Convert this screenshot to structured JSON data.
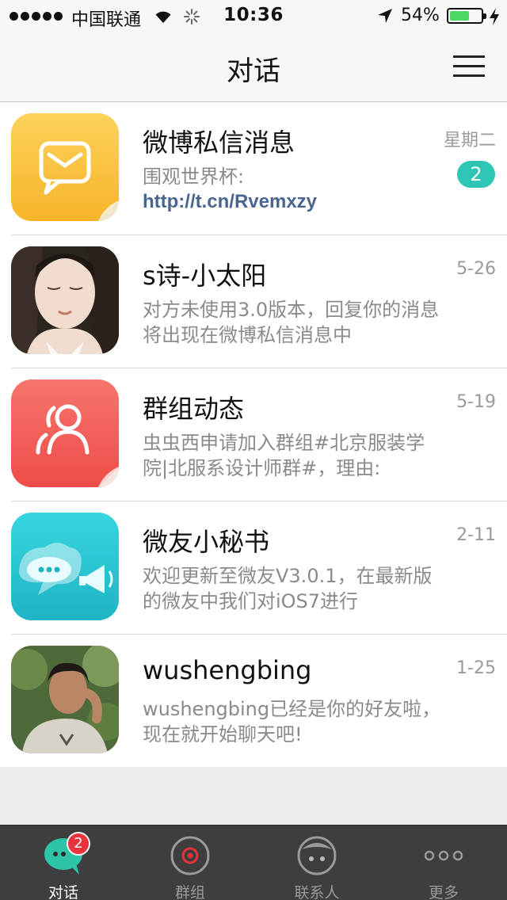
{
  "status_bar": {
    "carrier": "中国联通",
    "time": "10:36",
    "battery_pct": "54%"
  },
  "nav": {
    "title": "对话"
  },
  "conversations": [
    {
      "name": "微博私信消息",
      "date": "星期二",
      "preview_line1": "围观世界杯:",
      "preview_link": "http://t.cn/Rvemxzy",
      "unread": "2",
      "icon": "mail-icon",
      "color": "#f9c23c"
    },
    {
      "name": "s诗-小太阳",
      "date": "5-26",
      "preview": "对方未使用3.0版本，回复你的消息将出现在微博私信消息中",
      "icon": "user-photo"
    },
    {
      "name": "群组动态",
      "date": "5-19",
      "preview": "虫虫西申请加入群组#北京服装学院|北服系设计师群#，理由:",
      "icon": "group-icon",
      "color": "#f2605a"
    },
    {
      "name": "微友小秘书",
      "date": "2-11",
      "preview": "欢迎更新至微友V3.0.1，在最新版的微友中我们对iOS7进行",
      "icon": "chat-megaphone-icon",
      "color": "#2cc4d2"
    },
    {
      "name": "wushengbing",
      "date": "1-25",
      "preview": "wushengbing已经是你的好友啦，现在就开始聊天吧!",
      "icon": "user-photo"
    }
  ],
  "tabs": [
    {
      "label": "对话",
      "icon": "chat-bubble-icon",
      "badge": "2",
      "active": true
    },
    {
      "label": "群组",
      "icon": "group-target-icon"
    },
    {
      "label": "联系人",
      "icon": "contact-face-icon"
    },
    {
      "label": "更多",
      "icon": "more-dots-icon"
    }
  ],
  "colors": {
    "accent": "#2ec4b6",
    "badge_red": "#e8323c",
    "tabbar": "#3e3e3e"
  }
}
